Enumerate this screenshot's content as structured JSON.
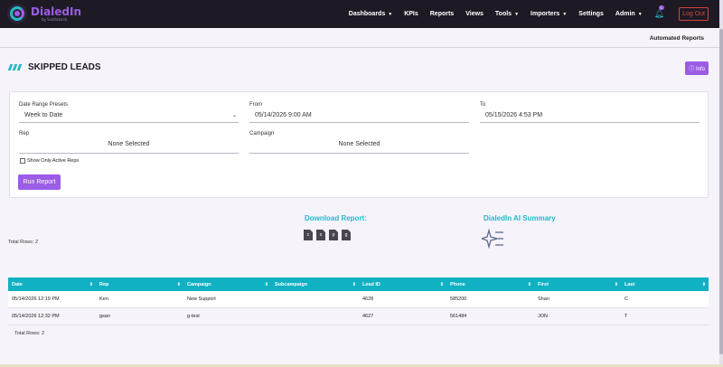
{
  "brand": {
    "name": "DialedIn",
    "sub": "by Scotiabank"
  },
  "nav": {
    "items": [
      {
        "label": "Dashboards",
        "dropdown": true
      },
      {
        "label": "KPIs",
        "dropdown": false
      },
      {
        "label": "Reports",
        "dropdown": false
      },
      {
        "label": "Views",
        "dropdown": false
      },
      {
        "label": "Tools",
        "dropdown": true
      },
      {
        "label": "Importers",
        "dropdown": true
      },
      {
        "label": "Settings",
        "dropdown": false
      },
      {
        "label": "Admin",
        "dropdown": true
      }
    ],
    "bell_badge": "1",
    "logout": "Log Out"
  },
  "subbar": {
    "link": "Automated Reports"
  },
  "page": {
    "title": "SKIPPED LEADS",
    "info_label": "Info"
  },
  "filters": {
    "date_range_label": "Date Range Presets",
    "date_range_value": "Week to Date",
    "from_label": "From",
    "from_value": "05/14/2026 9:00 AM",
    "to_label": "To",
    "to_value": "05/15/2026 4:53 PM",
    "rep_label": "Rep",
    "rep_value": "None Selected",
    "campaign_label": "Campaign",
    "campaign_value": "None Selected",
    "active_reps_label": "Show Only Active Reps",
    "run_label": "Run Report"
  },
  "summary": {
    "total_rows_top": "Total Rows: 2",
    "download_title": "Download Report:",
    "download_icons": [
      "csv-icon",
      "excel-icon",
      "pdf-icon",
      "google-sheets-icon"
    ],
    "ai_title": "DialedIn AI Summary"
  },
  "table": {
    "headers": [
      "Date",
      "Rep",
      "Campaign",
      "Subcampaign",
      "Lead ID",
      "Phone",
      "First",
      "Last"
    ],
    "rows": [
      [
        "05/14/2026 12:19 PM",
        "Ken",
        "New Support",
        "",
        "4628",
        "585200",
        "Shari",
        "C"
      ],
      [
        "05/14/2026 12:32 PM",
        "gsan",
        "g-test",
        "",
        "4627",
        "561484",
        "JON",
        "T"
      ]
    ],
    "total_rows_bottom": "Total Rows: 2"
  },
  "colors": {
    "accent": "#9b5de5",
    "teal": "#0fb1c3",
    "nav_bg": "#1e1a24"
  }
}
